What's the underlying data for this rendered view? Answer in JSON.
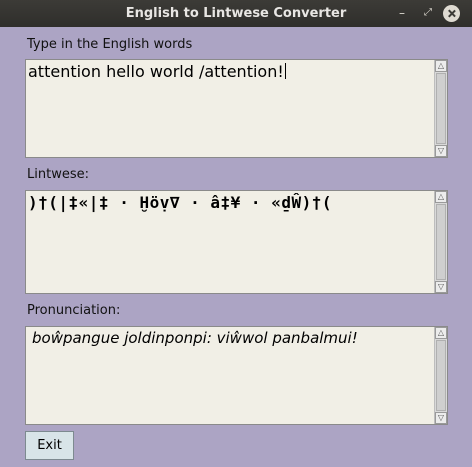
{
  "window": {
    "title": "English to Lintwese Converter",
    "controls": {
      "minimize": "–",
      "maximize": "⤢",
      "close": "×"
    }
  },
  "english": {
    "label": "Type in the English words",
    "value": "attention hello world /attention!"
  },
  "lintwese": {
    "label": "Lintwese:",
    "value": ")†(|‡«|‡ · Ḫöṿ∇ · â‡¥ · «ḏŴ)†("
  },
  "pronunciation": {
    "label": "Pronunciation:",
    "value": "boŵpangue joldinponpi: viŵwol panbalmui!"
  },
  "buttons": {
    "exit": "Exit"
  },
  "scrollbar": {
    "up_arrow": "△",
    "down_arrow": "▽"
  }
}
